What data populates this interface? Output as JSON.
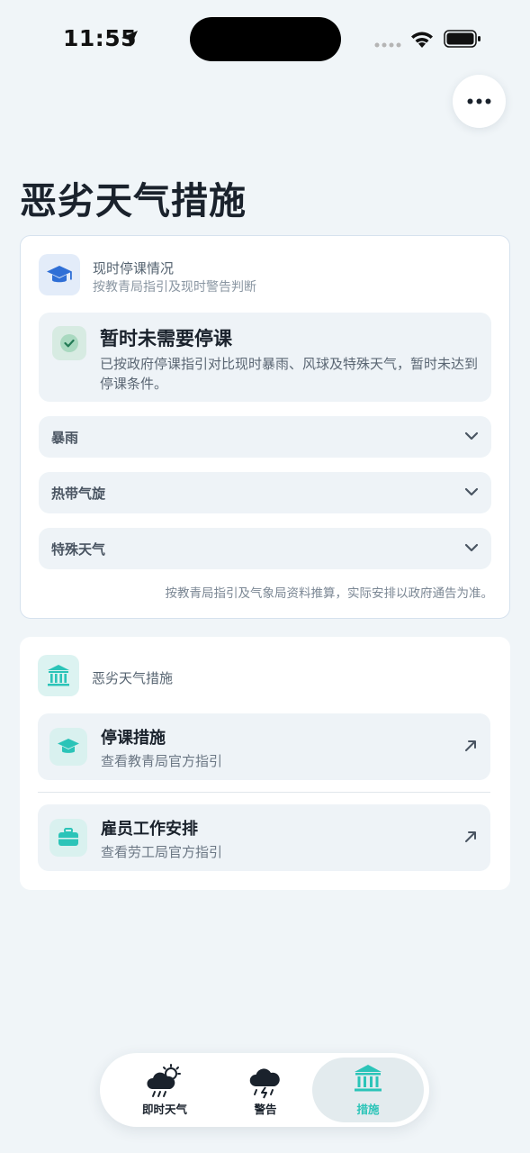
{
  "status_bar": {
    "time": "11:55"
  },
  "page": {
    "title": "恶劣天气措施"
  },
  "school_status": {
    "header_title": "现时停课情况",
    "header_subtitle": "按教青局指引及现时警告判断",
    "status_title": "暂时未需要停课",
    "status_desc": "已按政府停课指引对比现时暴雨、风球及特殊天气，暂时未达到停课条件。",
    "sections": [
      {
        "label": "暴雨"
      },
      {
        "label": "热带气旋"
      },
      {
        "label": "特殊天气"
      }
    ],
    "footnote": "按教青局指引及气象局资料推算，实际安排以政府通告为准。"
  },
  "measures": {
    "header_title": "恶劣天气措施",
    "items": [
      {
        "title": "停课措施",
        "subtitle": "查看教青局官方指引"
      },
      {
        "title": "雇员工作安排",
        "subtitle": "查看劳工局官方指引"
      }
    ]
  },
  "tabbar": {
    "tabs": [
      {
        "label": "即时天气",
        "active": false
      },
      {
        "label": "警告",
        "active": false
      },
      {
        "label": "措施",
        "active": true
      }
    ]
  },
  "colors": {
    "accent": "#2bc4b8",
    "school_icon": "#2f6fd6",
    "check": "#3a9a6a"
  }
}
